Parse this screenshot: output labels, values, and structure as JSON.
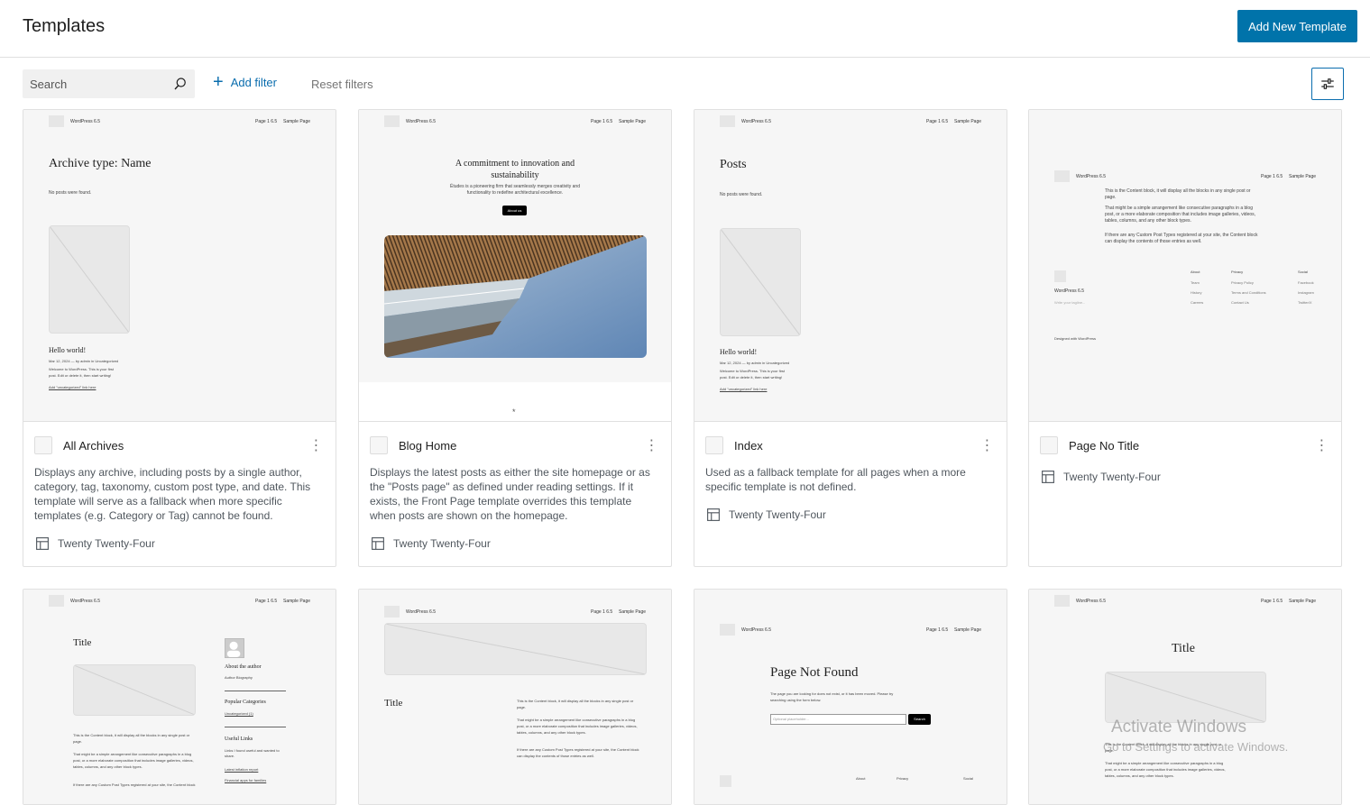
{
  "header": {
    "title": "Templates",
    "add_button": "Add New Template"
  },
  "toolbar": {
    "search_placeholder": "Search",
    "add_filter": "Add filter",
    "reset_filters": "Reset filters"
  },
  "preview": {
    "site_title": "WordPress 6.5",
    "nav_page": "Page 1 6.5",
    "nav_sample": "Sample Page",
    "archive_heading": "Archive type: Name",
    "no_posts": "No posts were found.",
    "hello_world": "Hello world!",
    "post_meta": "Mar 12, 2024 — by admin in Uncategorized",
    "post_excerpt_1": "Welcome to WordPress. This is your first",
    "post_excerpt_2": "post. Edit or delete it, then start writing!",
    "post_add_link": "Add \"uncategorized\" link here",
    "blog_heading_1": "A commitment to innovation and",
    "blog_heading_2": "sustainability",
    "blog_sub_1": "Études is a pioneering firm that seamlessly merges creativity and",
    "blog_sub_2": "functionality to redefine architectural excellence.",
    "about_us": "About us",
    "posts_heading": "Posts",
    "content_p1_1": "This is the Content block, it will display all the blocks in any single post or",
    "content_p1_2": "page.",
    "content_p2_1": "That might be a simple arrangement like consecutive paragraphs in a blog",
    "content_p2_2": "post, or a more elaborate composition that includes image galleries, videos,",
    "content_p2_3": "tables, columns, and any other block types.",
    "content_p3_1": "If there are any Custom Post Types registered at your site, the Content block",
    "content_p3_2": "can display the contents of those entries as well.",
    "footer_site": "WordPress 6.5",
    "footer_tagline": "Write your tagline...",
    "footer_cols": [
      {
        "head": "About",
        "items": [
          "Team",
          "History",
          "Careers"
        ]
      },
      {
        "head": "Privacy",
        "items": [
          "Privacy Policy",
          "Terms and Conditions",
          "Contact Us"
        ]
      },
      {
        "head": "Social",
        "items": [
          "Facebook",
          "Instagram",
          "Twitter/X"
        ]
      }
    ],
    "designed_with": "Designed with WordPress",
    "title": "Title",
    "about_author": "About the author",
    "author_bio": "Author Biography",
    "popular_categories": "Popular Categories",
    "uncategorized": "Uncategorized (1)",
    "useful_links": "Useful Links",
    "useful_links_desc_1": "Links I found useful and wanted to",
    "useful_links_desc_2": "share.",
    "latest_inflation": "Latest inflation report",
    "financial_apps": "Financial apps for families",
    "page_not_found": "Page Not Found",
    "pnf_text_1": "The page you are looking for does not exist, or it has been moved. Please try",
    "pnf_text_2": "searching using the form below.",
    "pnf_placeholder": "Optional placeholder...",
    "pnf_search": "Search"
  },
  "cards": [
    {
      "title": "All Archives",
      "description": "Displays any archive, including posts by a single author, category, tag, taxonomy, custom post type, and date. This template will serve as a fallback when more specific templates (e.g. Category or Tag) cannot be found.",
      "author": "Twenty Twenty-Four"
    },
    {
      "title": "Blog Home",
      "description": "Displays the latest posts as either the site homepage or as the \"Posts page\" as defined under reading settings. If it exists, the Front Page template overrides this template when posts are shown on the homepage.",
      "author": "Twenty Twenty-Four"
    },
    {
      "title": "Index",
      "description": "Used as a fallback template for all pages when a more specific template is not defined.",
      "author": "Twenty Twenty-Four"
    },
    {
      "title": "Page No Title",
      "description": "",
      "author": "Twenty Twenty-Four"
    }
  ],
  "watermark": {
    "line1": "Activate Windows",
    "line2": "Go to Settings to activate Windows."
  },
  "colors": {
    "accent": "#0073aa",
    "link": "#0a6dae"
  }
}
